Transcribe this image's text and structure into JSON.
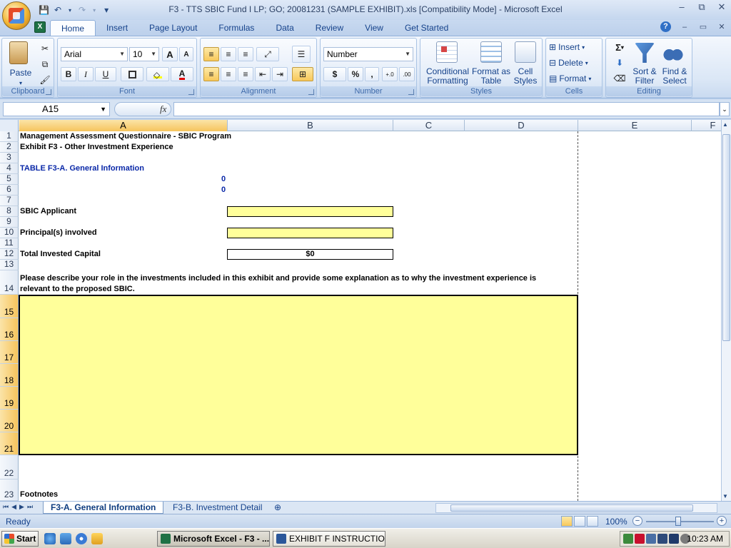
{
  "window": {
    "title": "F3 - TTS SBIC Fund I LP; GO; 20081231 (SAMPLE EXHIBIT).xls  [Compatibility Mode] - Microsoft Excel",
    "minimize": "–",
    "restore": "⧉",
    "close": "✕"
  },
  "quick_access": {
    "save": "💾",
    "undo": "↶",
    "redo": "↷",
    "customize": "▾"
  },
  "tabs": [
    "Home",
    "Insert",
    "Page Layout",
    "Formulas",
    "Data",
    "Review",
    "View",
    "Get Started"
  ],
  "ribbon": {
    "clipboard": {
      "label": "Clipboard",
      "paste": "Paste"
    },
    "font": {
      "label": "Font",
      "name": "Arial",
      "size": "10",
      "grow": "A",
      "shrink": "A",
      "bold": "B",
      "italic": "I",
      "underline": "U"
    },
    "alignment": {
      "label": "Alignment"
    },
    "number": {
      "label": "Number",
      "format": "Number",
      "currency": "$",
      "percent": "%",
      "comma": ",",
      "inc_decimal": "+.0",
      "dec_decimal": ".00"
    },
    "styles": {
      "label": "Styles",
      "conditional": "Conditional Formatting",
      "format_table": "Format as Table",
      "cell_styles": "Cell Styles"
    },
    "cells": {
      "label": "Cells",
      "insert": "Insert",
      "delete": "Delete",
      "format": "Format"
    },
    "editing": {
      "label": "Editing",
      "sum": "Σ",
      "sort": "Sort & Filter",
      "find": "Find & Select"
    }
  },
  "formula_bar": {
    "name_box": "A15",
    "fx": "fx",
    "content": ""
  },
  "columns": [
    "A",
    "B",
    "C",
    "D",
    "E",
    "F"
  ],
  "rows": [
    "1",
    "2",
    "3",
    "4",
    "5",
    "6",
    "7",
    "8",
    "9",
    "10",
    "11",
    "12",
    "13",
    "14",
    "15",
    "16",
    "17",
    "18",
    "19",
    "20",
    "21",
    "22",
    "23"
  ],
  "cells": {
    "a1": "Management Assessment Questionnaire - SBIC Program",
    "a2": "Exhibit F3 - Other Investment Experience",
    "a4": "TABLE F3-A.  General Information",
    "b5": "0",
    "b6": "0",
    "a8": "SBIC Applicant",
    "a10": "Principal(s) involved",
    "a12": "Total Invested Capital",
    "b12": "$0",
    "a14_line1": "Please describe your role in the investments included in this exhibit and provide some explanation as to why the investment experience is",
    "a14_line2": "relevant to the proposed SBIC.",
    "a23": "Footnotes"
  },
  "sheet_tabs": [
    "F3-A. General Information",
    "F3-B. Investment Detail"
  ],
  "status": {
    "ready": "Ready",
    "zoom": "100%",
    "zoom_minus": "−",
    "zoom_plus": "+"
  },
  "taskbar": {
    "start": "Start",
    "tasks": [
      "Microsoft Excel - F3 - ...",
      "EXHIBIT F INSTRUCTION..."
    ],
    "clock": "10:23 AM"
  },
  "colors": {
    "selection": "#f6c45d",
    "input_fill": "#ffff9a",
    "header_blue": "#0a28a8"
  }
}
